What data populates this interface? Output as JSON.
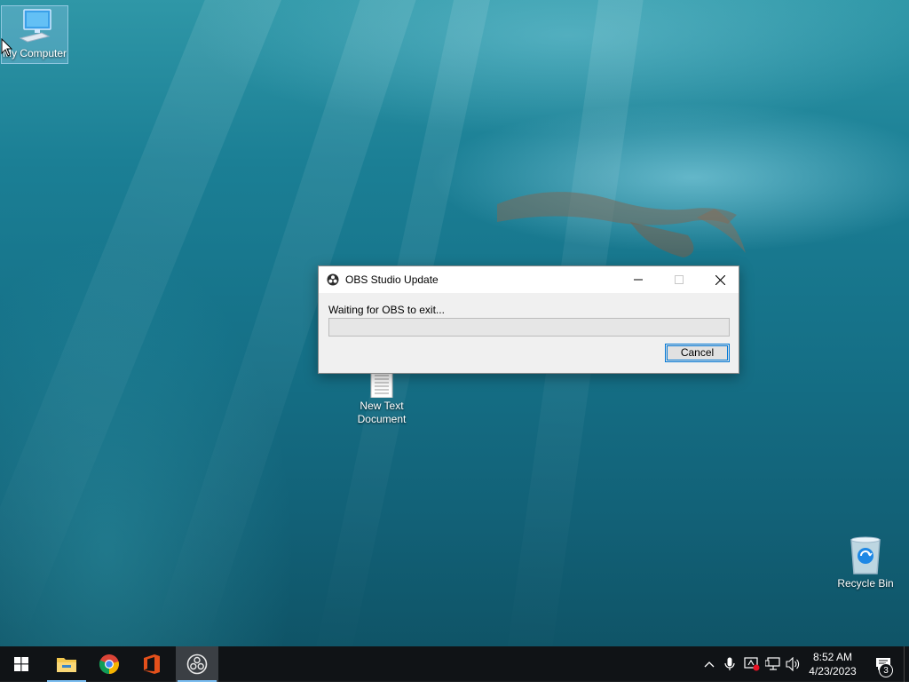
{
  "desktop": {
    "icons": {
      "my_computer": "My Computer",
      "text_document": "New Text\nDocument",
      "recycle_bin": "Recycle Bin"
    }
  },
  "dialog": {
    "title": "OBS Studio Update",
    "status": "Waiting for OBS to exit...",
    "progress_fraction": 0,
    "cancel_label": "Cancel",
    "title_icon": "obs-logo-icon"
  },
  "taskbar": {
    "apps": [
      "file-explorer-icon",
      "chrome-icon",
      "office-icon",
      "obs-icon"
    ],
    "tray_icons": [
      "chevron-up-icon",
      "microphone-icon",
      "security-alert-icon",
      "network-icon",
      "volume-icon"
    ],
    "time": "8:52 AM",
    "date": "4/23/2023",
    "notification_count": "3"
  },
  "colors": {
    "accent": "#0078d7",
    "taskbar": "#101316",
    "progress_fill": "#06b025"
  }
}
